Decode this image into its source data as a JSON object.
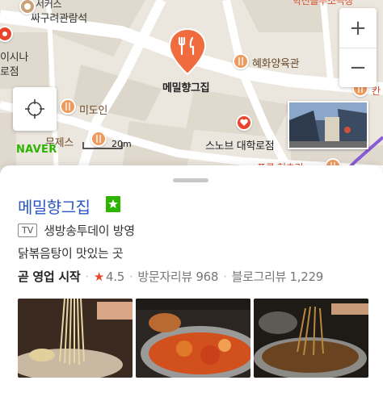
{
  "map": {
    "labels": {
      "top_partial_1": "서커스",
      "top_partial_2": "싸구려관람석",
      "top_right_partial": "학전블루소극장",
      "left_partial_1": "이시나",
      "left_partial_2": "로점",
      "main_place": "메밀향그집",
      "hyehwa": "혜화양육관",
      "midoin": "미도인",
      "mujesuk": "무제스",
      "snob": "스노브 대학로점",
      "right_partial": "칸",
      "bottom_partial": "프루 현초리"
    },
    "scale_label": "20m",
    "logo": "NAVER",
    "zoom_in": "+",
    "zoom_out": "−",
    "colors": {
      "road": "#ffffff",
      "block": "#e3ddd3",
      "poi": "#ef9a5a",
      "marker": "#f06b3d",
      "naver": "#2db400"
    }
  },
  "panel": {
    "title": "메밀향그집",
    "tv_badge": "TV",
    "tv_text": "생방송투데이 방영",
    "description": "닭볶음탕이 맛있는 곳",
    "status": "곧 영업 시작",
    "rating_star": "★",
    "rating": "4.5",
    "visitor_reviews": "방문자리뷰 968",
    "blog_reviews": "블로그리뷰 1,229",
    "separator": "·",
    "colors": {
      "title": "#2a57c4",
      "star": "#e8452c",
      "badge": "#2db400"
    }
  }
}
